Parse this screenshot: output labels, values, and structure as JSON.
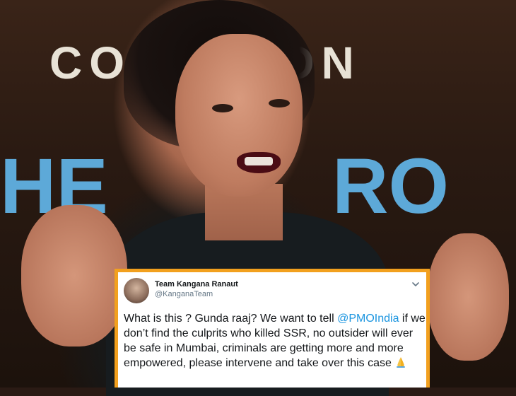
{
  "background": {
    "backdrop_text_top": "CO  SATION",
    "backdrop_text_left": "HE",
    "backdrop_text_right": "RO"
  },
  "tweet": {
    "display_name": "Team Kangana Ranaut",
    "handle": "@KanganaTeam",
    "text_before_mention": "What is this ? Gunda raaj? We want to tell ",
    "mention": "@PMOIndia",
    "text_after_mention": " if we don’t find the culprits who killed SSR, no outsider will ever be safe in Mumbai, criminals are getting more and more empowered, please intervene and take over this case",
    "emoji_icon": "folded-hands-icon",
    "menu_icon": "chevron-down-icon",
    "border_color": "#f2a01e",
    "mention_color": "#1b95e0"
  }
}
